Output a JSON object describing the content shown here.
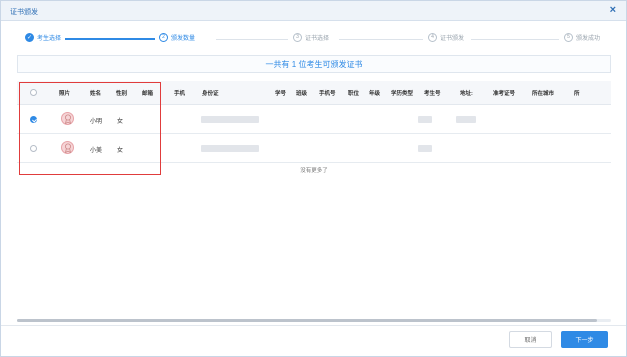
{
  "window": {
    "title": "证书颁发",
    "close_glyph": "×"
  },
  "steps": [
    {
      "label": "考生选择",
      "index": "✓",
      "state": "done"
    },
    {
      "label": "颁发数量",
      "index": "2",
      "state": "current"
    },
    {
      "label": "证书选择",
      "index": "3",
      "state": "todo"
    },
    {
      "label": "证书颁发",
      "index": "4",
      "state": "todo"
    },
    {
      "label": "颁发成功",
      "index": "5",
      "state": "todo"
    }
  ],
  "summary": "一共有 1 位考生可颁发证书",
  "table": {
    "columns": [
      "照片",
      "姓名",
      "性别",
      "邮箱",
      "手机",
      "身份证",
      "学号",
      "班级",
      "手机号",
      "职位",
      "年级",
      "学历类型",
      "考生号",
      "地址:",
      "准考证号",
      "所在城市",
      "所"
    ],
    "rows": [
      {
        "name": "小明",
        "gender": "女",
        "selected": true
      },
      {
        "name": "小美",
        "gender": "女",
        "selected": false
      }
    ],
    "no_more": "没有更多了"
  },
  "footer": {
    "cancel_label": "取消",
    "next_label": "下一步"
  },
  "colors": {
    "accent": "#2f8ae5",
    "highlight_border": "#e03c3c"
  }
}
